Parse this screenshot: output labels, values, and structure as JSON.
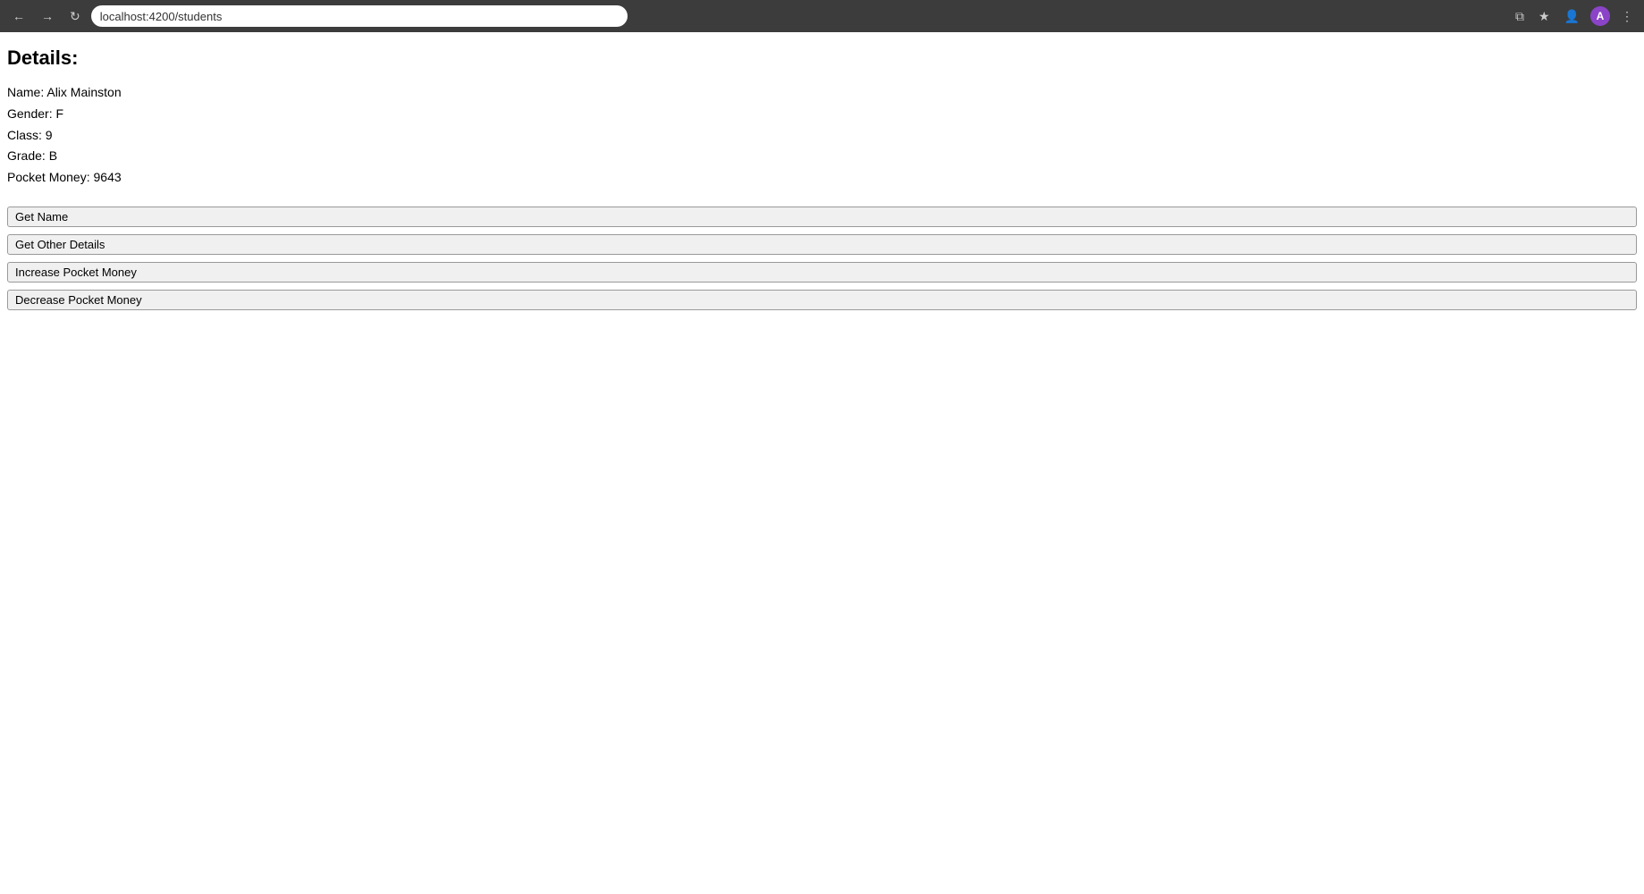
{
  "browser": {
    "url": "localhost:4200/students",
    "avatar_label": "A"
  },
  "page": {
    "title": "Details:",
    "student": {
      "name_label": "Name:",
      "name_value": "Alix Mainston",
      "gender_label": "Gender:",
      "gender_value": "F",
      "class_label": "Class:",
      "class_value": "9",
      "grade_label": "Grade:",
      "grade_value": "B",
      "pocket_money_label": "Pocket Money:",
      "pocket_money_value": "9643"
    },
    "buttons": {
      "get_name": "Get Name",
      "get_other_details": "Get Other Details",
      "increase_pocket_money": "Increase Pocket Money",
      "decrease_pocket_money": "Decrease Pocket Money"
    }
  }
}
